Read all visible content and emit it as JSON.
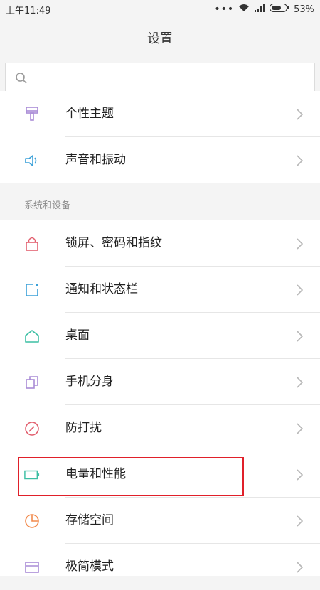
{
  "status_bar": {
    "time": "上午11:49",
    "battery": "53%"
  },
  "header": {
    "title": "设置"
  },
  "search": {
    "placeholder": "",
    "value": ""
  },
  "group1": [
    {
      "label": "个性主题",
      "icon": "theme-brush-icon"
    },
    {
      "label": "声音和振动",
      "icon": "speaker-icon"
    }
  ],
  "section": {
    "title": "系统和设备"
  },
  "group2": [
    {
      "label": "锁屏、密码和指纹",
      "icon": "lock-icon"
    },
    {
      "label": "通知和状态栏",
      "icon": "notification-icon"
    },
    {
      "label": "桌面",
      "icon": "home-icon"
    },
    {
      "label": "手机分身",
      "icon": "second-space-icon"
    },
    {
      "label": "防打扰",
      "icon": "do-not-disturb-icon"
    },
    {
      "label": "电量和性能",
      "icon": "battery-icon"
    },
    {
      "label": "存储空间",
      "icon": "storage-pie-icon"
    },
    {
      "label": "极简模式",
      "icon": "lite-mode-icon"
    }
  ],
  "colors": {
    "theme": "#a98bd6",
    "sound": "#3aa0d8",
    "lock": "#e2606f",
    "notification": "#3aa0d8",
    "home": "#3cbfa4",
    "second_space": "#a98bd6",
    "dnd": "#e2606f",
    "battery": "#3cbfa4",
    "storage": "#f28a4c",
    "lite": "#a98bd6",
    "highlight": "#e0202a"
  }
}
